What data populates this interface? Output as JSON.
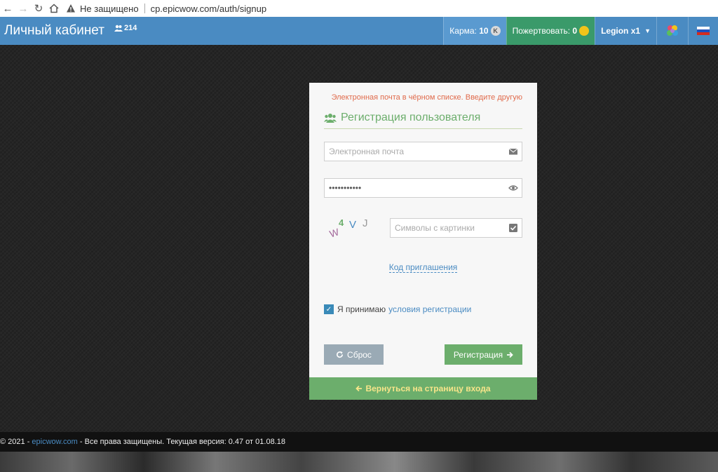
{
  "browser": {
    "security_label": "Не защищено",
    "url": "cp.epicwow.com/auth/signup"
  },
  "header": {
    "title": "Личный кабинет",
    "online_count": "214",
    "karma_label": "Карма:",
    "karma_value": "10",
    "karma_coin": "K",
    "donate_label": "Пожертвовать:",
    "donate_value": "0",
    "realm": "Legion x1"
  },
  "form": {
    "error": "Электронная почта в чёрном списке. Введите другую",
    "title": "Регистрация пользователя",
    "email_placeholder": "Электронная почта",
    "password_value": "•••••••••••",
    "captcha_chars": [
      "W",
      "4",
      "V",
      "J"
    ],
    "captcha_placeholder": "Символы с картинки",
    "invite_link": "Код приглашения",
    "agree_text": "Я принимаю",
    "agree_link": "условия регистрации",
    "reset_label": "Сброс",
    "register_label": "Регистрация",
    "back_label": "Вернуться на страницу входа"
  },
  "footer": {
    "copyright": "© 2021 -",
    "site": "epicwow.com",
    "rest": "- Все права защищены. Текущая версия: 0.47 от 01.08.18"
  },
  "colors": {
    "header": "#4a8bc2",
    "donate": "#3a9a6a",
    "success": "#6cae6c",
    "error": "#e06b4c",
    "link": "#4a8bc2"
  }
}
